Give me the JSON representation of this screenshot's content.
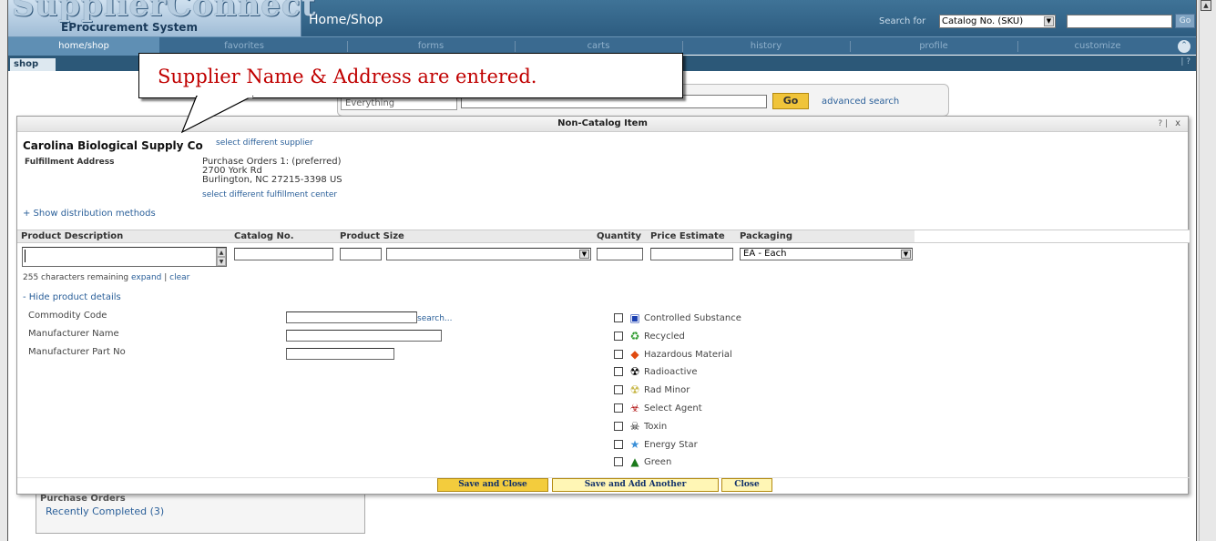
{
  "header": {
    "logo_text": "SupplierConnect",
    "logo_subtitle": "EProcurement System",
    "title": "Home/Shop",
    "search_label": "Search for",
    "search_type": "Catalog No. (SKU)",
    "go_label": "Go"
  },
  "nav": {
    "items": [
      "home/shop",
      "favorites",
      "forms",
      "carts",
      "history",
      "profile",
      "customize"
    ]
  },
  "subnav": {
    "tab_label": "shop",
    "help": "| ?"
  },
  "background_search": {
    "scope": "Everything",
    "go_label": "Go",
    "advanced_label": "advanced search"
  },
  "background_sidebar": {
    "section_title": "Purchase Orders",
    "recent_link": "Recently Completed (3)"
  },
  "callout": {
    "text": "Supplier Name & Address are entered."
  },
  "modal": {
    "title": "Non-Catalog Item",
    "help": "? |",
    "close_x": "x",
    "supplier_name": "Carolina Biological Supply Co",
    "select_supplier_link": "select different supplier",
    "fulfillment_label": "Fulfillment Address",
    "address_lines": [
      "Purchase Orders 1: (preferred)",
      "2700 York Rd",
      "Burlington, NC 27215-3398 US"
    ],
    "select_fulfillment_link": "select different fulfillment center",
    "show_distribution_link": "+ Show distribution methods",
    "columns": [
      "Product Description",
      "Catalog No.",
      "Product Size",
      "Quantity",
      "Price Estimate",
      "Packaging"
    ],
    "packaging_value": "EA - Each",
    "chars_remaining": "255 characters remaining",
    "expand_link": "expand",
    "clear_link": "clear",
    "hide_details_link": "- Hide product details",
    "details": {
      "commodity_code_label": "Commodity Code",
      "commodity_search_link": "search...",
      "manufacturer_name_label": "Manufacturer Name",
      "manufacturer_part_label": "Manufacturer Part No"
    },
    "flags": [
      {
        "label": "Controlled Substance",
        "icon": "controlled-substance-icon",
        "glyph": "▣",
        "color": "#1a3fb0"
      },
      {
        "label": "Recycled",
        "icon": "recycled-icon",
        "glyph": "♻",
        "color": "#2e9a2e"
      },
      {
        "label": "Hazardous Material",
        "icon": "hazardous-icon",
        "glyph": "◆",
        "color": "#e04a10"
      },
      {
        "label": "Radioactive",
        "icon": "radioactive-icon",
        "glyph": "☢",
        "color": "#000000"
      },
      {
        "label": "Rad Minor",
        "icon": "rad-minor-icon",
        "glyph": "☢",
        "color": "#c8b84a"
      },
      {
        "label": "Select Agent",
        "icon": "biohazard-icon",
        "glyph": "☣",
        "color": "#b01010"
      },
      {
        "label": "Toxin",
        "icon": "skull-icon",
        "glyph": "☠",
        "color": "#000000"
      },
      {
        "label": "Energy Star",
        "icon": "energy-star-icon",
        "glyph": "★",
        "color": "#3a8fd8"
      },
      {
        "label": "Green",
        "icon": "tree-icon",
        "glyph": "▲",
        "color": "#1a7a1a"
      }
    ],
    "buttons": {
      "save_close": "Save and Close",
      "save_add": "Save and Add Another",
      "close": "Close"
    }
  }
}
